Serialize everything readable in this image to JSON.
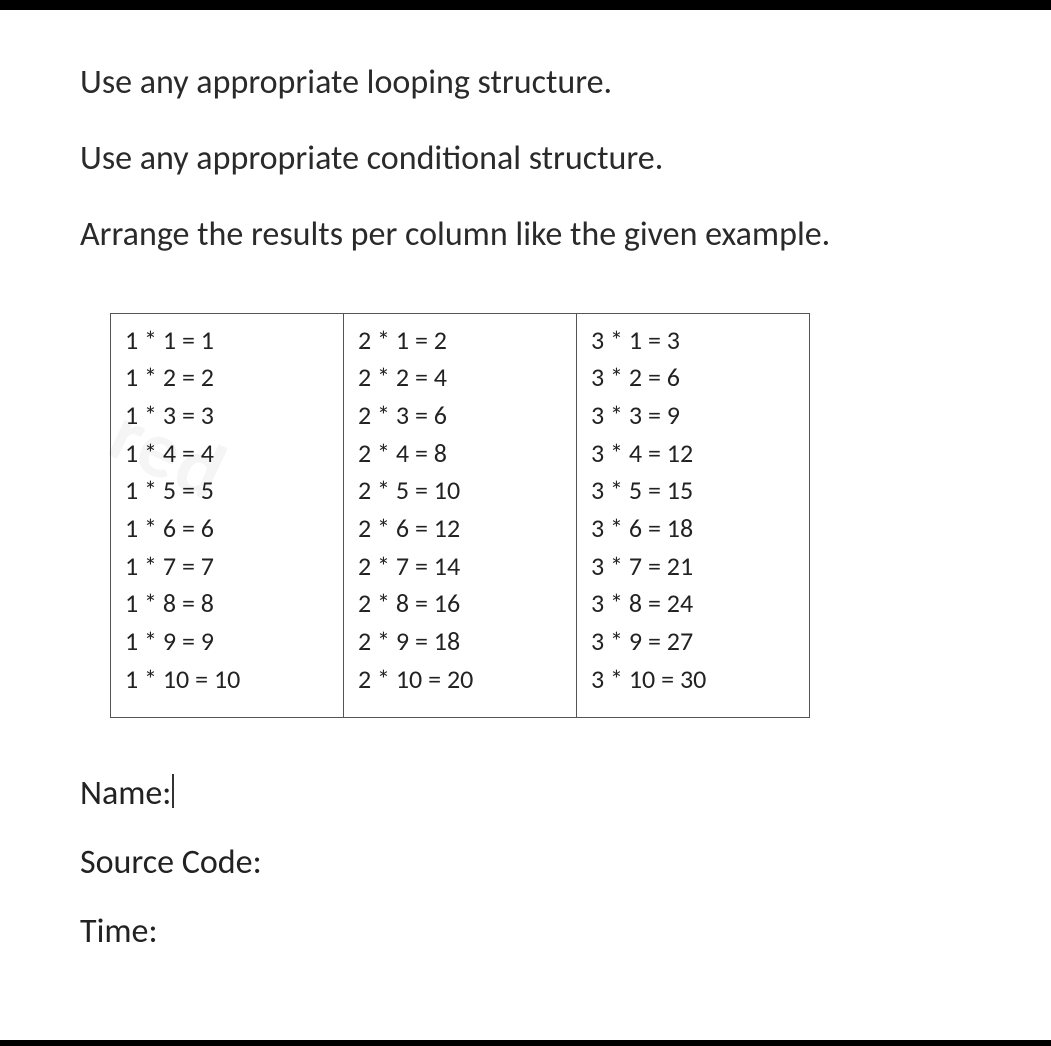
{
  "instructions": [
    "Use any appropriate looping structure.",
    "Use any appropriate conditional structure.",
    "Arrange the results per column like the given example."
  ],
  "table": {
    "columns": [
      [
        "1 * 1 = 1",
        "1 * 2 = 2",
        "1 * 3 = 3",
        "1 * 4 = 4",
        "1 * 5 = 5",
        "1 * 6 = 6",
        "1 * 7 = 7",
        "1 * 8 = 8",
        "1 * 9 = 9",
        "1 * 10 = 10"
      ],
      [
        "2 * 1 = 2",
        "2 * 2 = 4",
        "2 * 3 = 6",
        "2 * 4 = 8",
        "2 * 5 = 10",
        "2 * 6 = 12",
        "2 * 7 = 14",
        "2 * 8 = 16",
        "2 * 9 = 18",
        "2 * 10 = 20"
      ],
      [
        "3 * 1 = 3",
        "3 * 2 = 6",
        "3 * 3 = 9",
        "3 * 4 = 12",
        "3 * 5 = 15",
        "3 * 6 = 18",
        "3 * 7 = 21",
        "3 * 8 = 24",
        "3 * 9 = 27",
        "3 * 10 = 30"
      ]
    ]
  },
  "fields": {
    "name_label": "Name:",
    "source_code_label": "Source Code:",
    "time_label": "Time:"
  },
  "watermark": "red"
}
